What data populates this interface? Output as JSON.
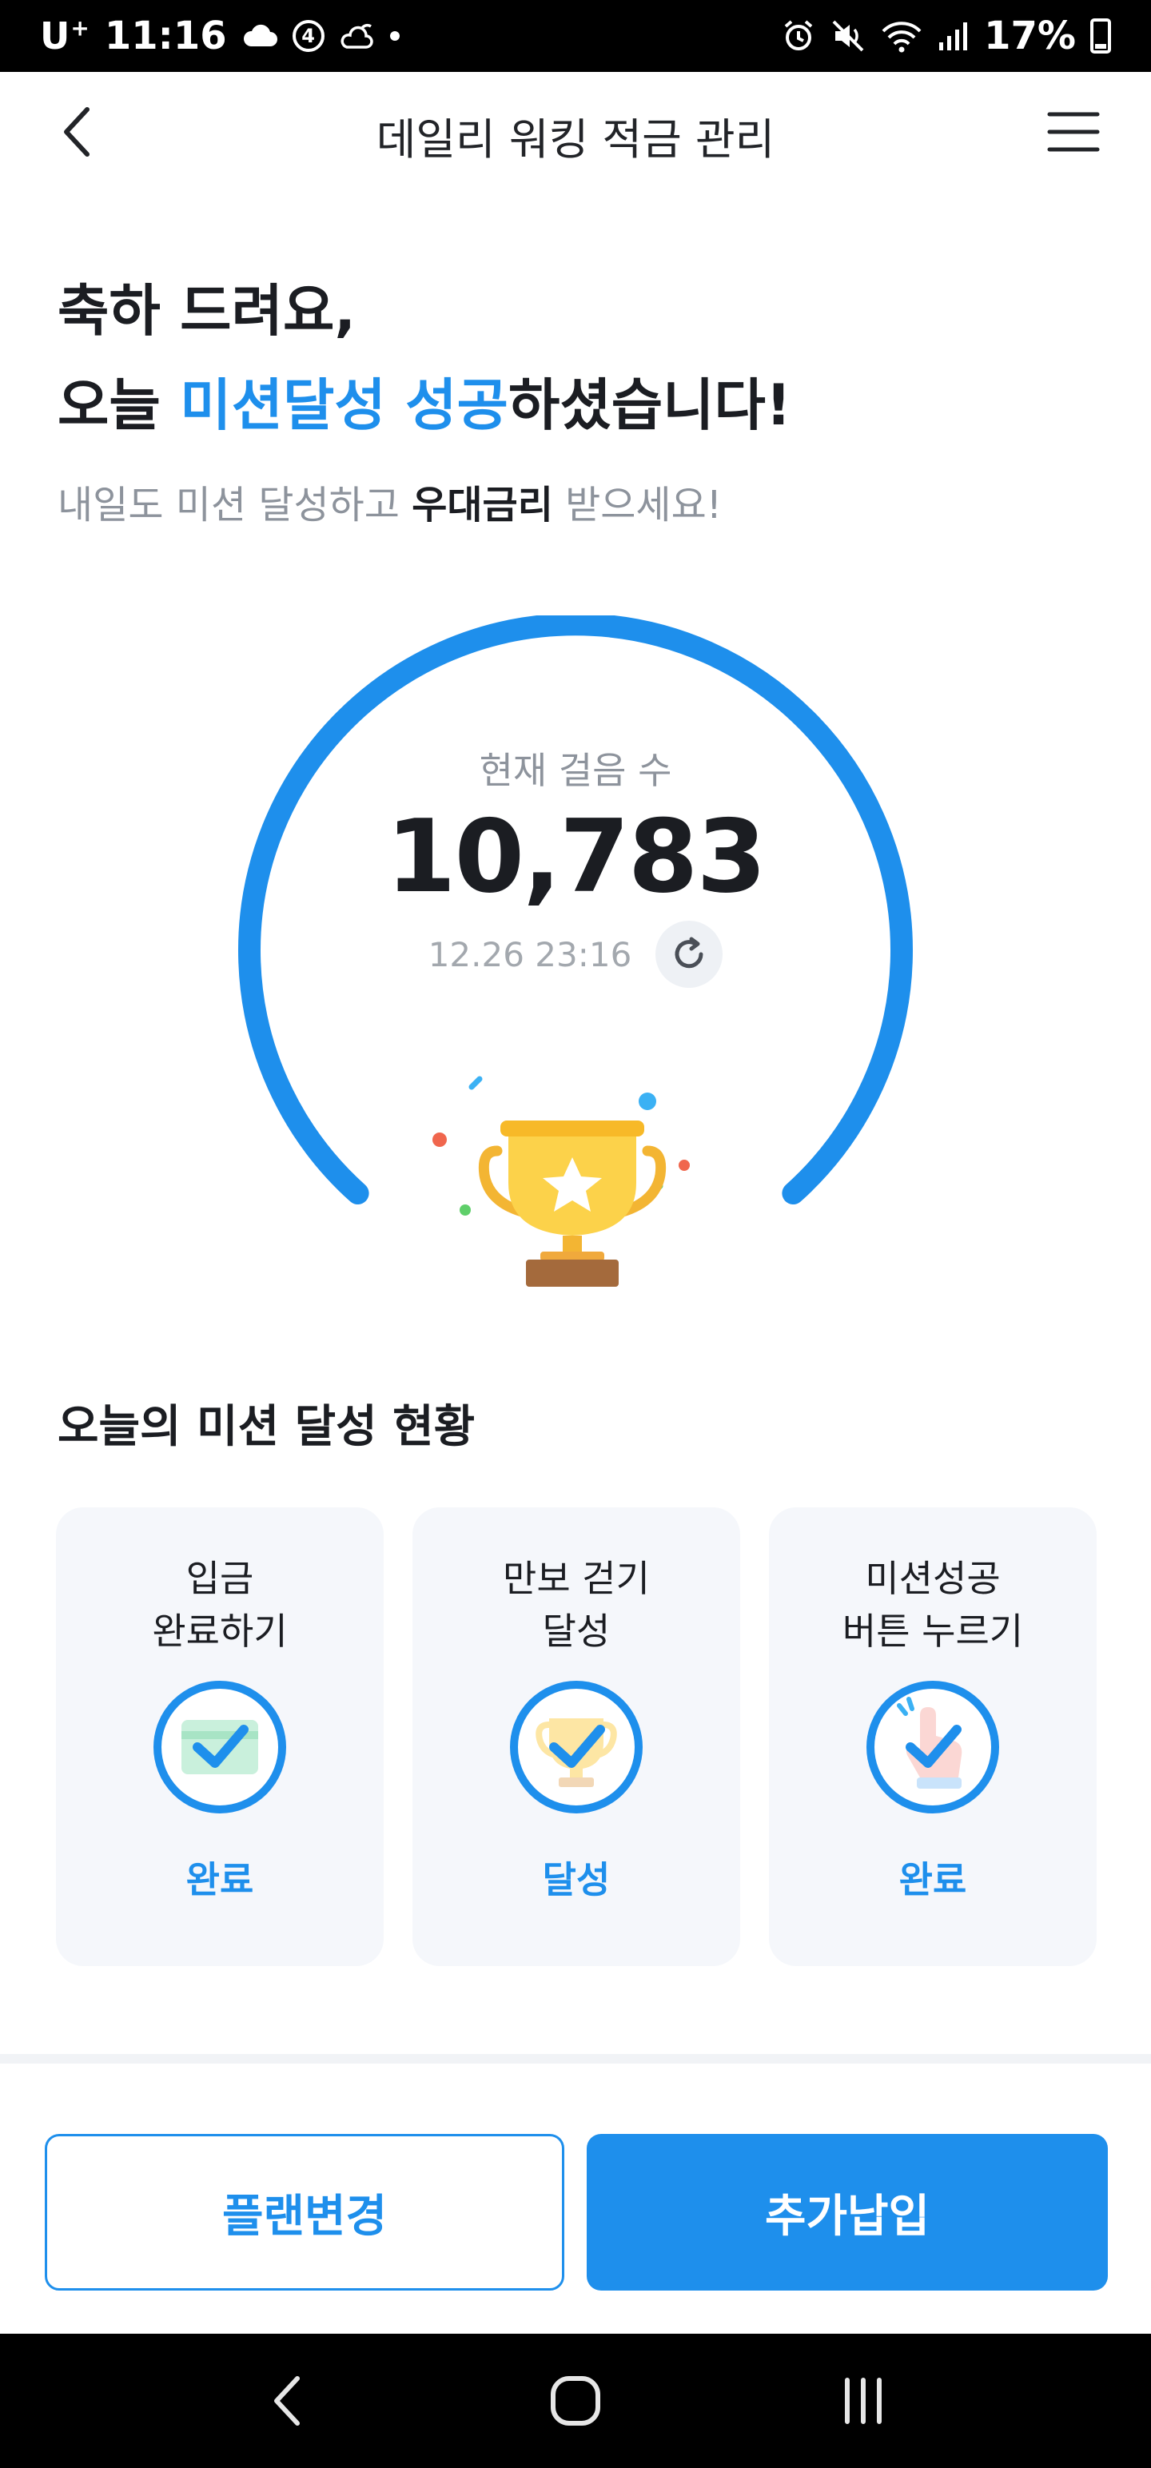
{
  "status_bar": {
    "carrier": "U",
    "carrier_sup": "+",
    "time": "11:16",
    "notification_count": "4",
    "battery": "17%",
    "icons": [
      "cloud-icon",
      "weather-icon",
      "dot-icon",
      "alarm-icon",
      "mute-icon",
      "wifi-icon",
      "signal-icon",
      "battery-icon"
    ]
  },
  "app_bar": {
    "title": "데일리 워킹 적금 관리",
    "back_icon": "chevron-left-icon",
    "menu_icon": "hamburger-menu-icon"
  },
  "headline": {
    "line1": "축하 드려요,",
    "line2_prefix": "오늘 ",
    "line2_accent": "미션달성 성공",
    "line2_suffix": "하셨습니다!",
    "sub_prefix": "내일도 미션 달성하고 ",
    "sub_strong": "우대금리",
    "sub_suffix": " 받으세요!"
  },
  "gauge": {
    "label": "현재 걸음 수",
    "steps": "10,783",
    "updated": "12.26 23:16",
    "progress": 1.0,
    "color": "#1e8fec"
  },
  "missions": {
    "title": "오늘의 미션 달성 현황",
    "cards": [
      {
        "title": "입금\n완료하기",
        "status": "완료",
        "icon": "deposit-check-icon"
      },
      {
        "title": "만보 걷기\n달성",
        "status": "달성",
        "icon": "trophy-check-icon"
      },
      {
        "title": "미션성공\n버튼 누르기",
        "status": "완료",
        "icon": "tap-check-icon"
      }
    ]
  },
  "buttons": {
    "change_plan": "플랜변경",
    "extra_payment": "추가납입"
  },
  "colors": {
    "accent": "#1e8fec",
    "card_bg": "#f5f7fb",
    "muted_text": "#8d939c"
  }
}
